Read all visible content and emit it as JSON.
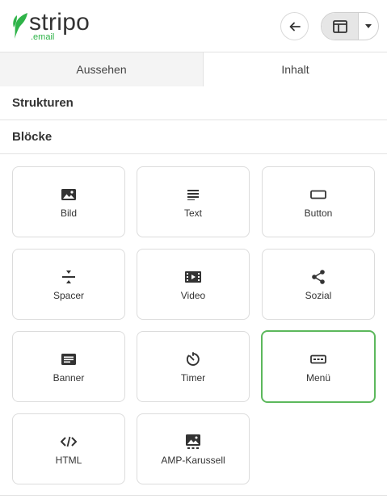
{
  "logo": {
    "word": "stripo",
    "sub": ".email"
  },
  "tabs": [
    {
      "label": "Aussehen"
    },
    {
      "label": "Inhalt"
    }
  ],
  "sections": {
    "structures": "Strukturen",
    "blocks": "Blöcke"
  },
  "blocks": [
    {
      "label": "Bild",
      "icon": "image-icon"
    },
    {
      "label": "Text",
      "icon": "text-icon"
    },
    {
      "label": "Button",
      "icon": "button-icon"
    },
    {
      "label": "Spacer",
      "icon": "spacer-icon"
    },
    {
      "label": "Video",
      "icon": "video-icon"
    },
    {
      "label": "Sozial",
      "icon": "share-icon"
    },
    {
      "label": "Banner",
      "icon": "banner-icon"
    },
    {
      "label": "Timer",
      "icon": "timer-icon"
    },
    {
      "label": "Menü",
      "icon": "menu-icon"
    },
    {
      "label": "HTML",
      "icon": "code-icon"
    },
    {
      "label": "AMP-Karussell",
      "icon": "carousel-icon"
    }
  ],
  "colors": {
    "brand_green": "#2eb348",
    "selected_border": "#5cb85c",
    "icon": "#333333"
  }
}
